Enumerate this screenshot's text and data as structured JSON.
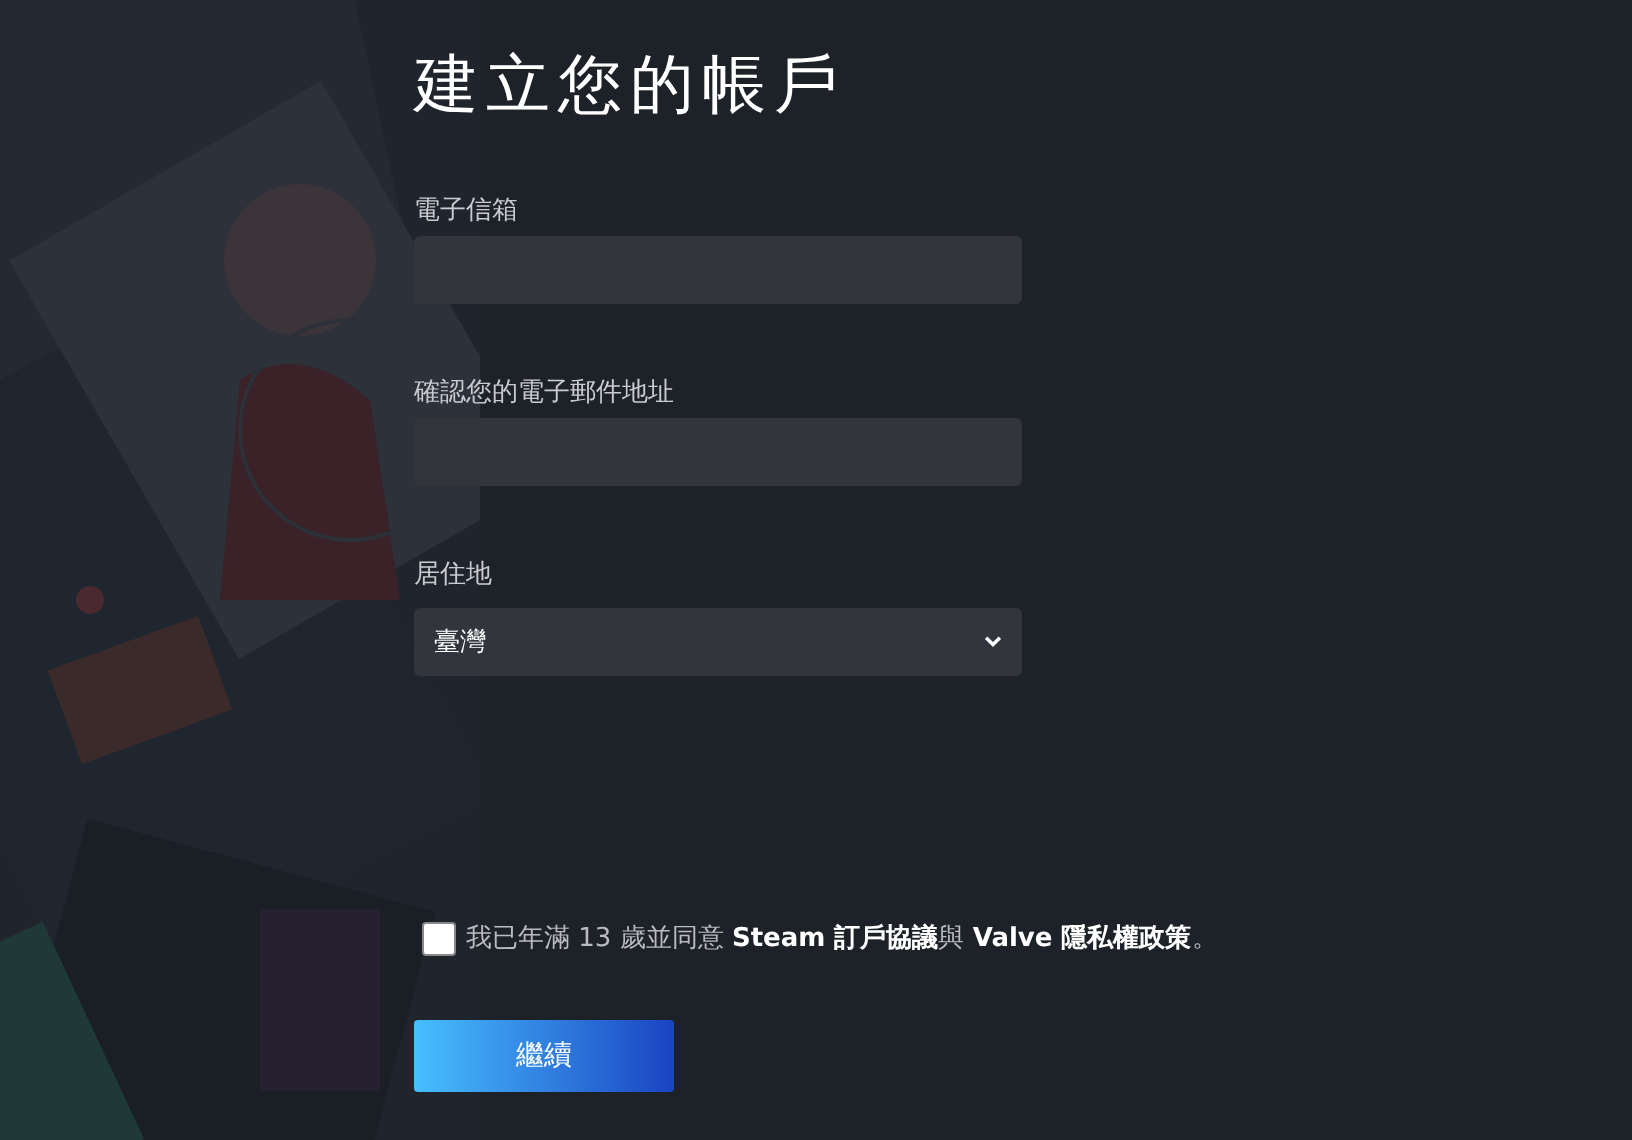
{
  "title": "建立您的帳戶",
  "fields": [
    {
      "kind": "text",
      "label": "電子信箱"
    },
    {
      "kind": "text",
      "label": "確認您的電子郵件地址"
    },
    {
      "kind": "select",
      "label": "居住地",
      "value": "臺灣"
    }
  ],
  "agreement": {
    "text": "我已年滿 13 歲並同意 **Steam 訂戶協議**與 **Valve 隱私權政策**。",
    "checked": false
  },
  "button": "繼續"
}
